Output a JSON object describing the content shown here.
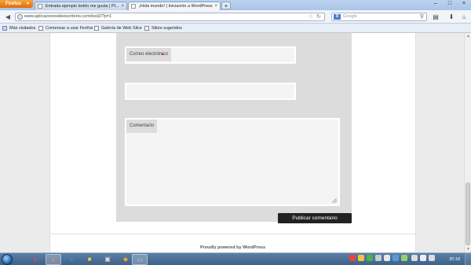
{
  "browser": {
    "menu_button": "Firefox",
    "tabs": [
      {
        "label": "Entrada ejemplo botón me gusta | Pl...",
        "active": false
      },
      {
        "label": "¡Hola mundo! | Iniciación a WordPress",
        "active": true
      }
    ],
    "new_tab": "+",
    "url": "www.aplicacionesdeescritorio.com/test2/?p=1",
    "search_engine": "Google",
    "search_placeholder": "Google"
  },
  "bookmarks": [
    {
      "label": "Más visitados"
    },
    {
      "label": "Comenzar a usar Firefox"
    },
    {
      "label": "Galería de Web Slice"
    },
    {
      "label": "Sitios sugeridos"
    }
  ],
  "form": {
    "email_label": "Correo electrónico",
    "comment_label": "Comentario",
    "submit_label": "Publicar comentario"
  },
  "footer": {
    "text": "Proudly powered by WordPress"
  },
  "taskbar": {
    "clock": "20:18"
  }
}
